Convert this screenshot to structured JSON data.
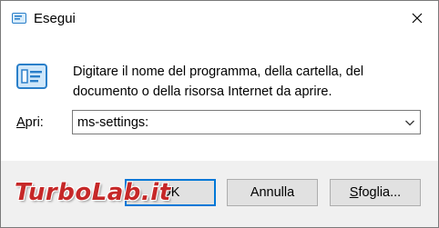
{
  "window": {
    "title": "Esegui",
    "title_icon": "run-icon",
    "close_icon": "close-icon"
  },
  "content": {
    "icon": "run-icon",
    "message_line1": "Digitare il nome del programma, della cartella, del",
    "message_line2": "documento o della risorsa Internet da aprire."
  },
  "open_field": {
    "label_underlined": "A",
    "label_rest": "pri:",
    "value": "ms-settings:",
    "dropdown_icon": "chevron-down-icon"
  },
  "buttons": {
    "ok": "OK",
    "cancel": "Annulla",
    "browse_underlined": "S",
    "browse_rest": "foglia..."
  },
  "watermark": "TurboLab.it",
  "colors": {
    "accent": "#0078d7",
    "watermark": "#c62828",
    "footer": "#f0f0f0"
  }
}
